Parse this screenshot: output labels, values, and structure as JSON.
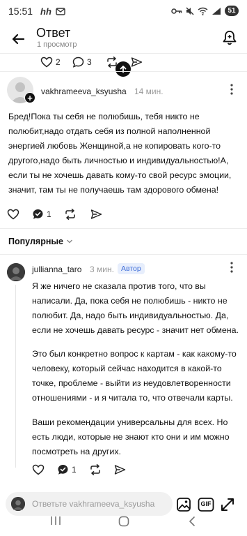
{
  "status_bar": {
    "time": "15:51",
    "battery": "51",
    "icons": [
      "hh-icon",
      "mail-icon",
      "key-icon",
      "mute-icon",
      "wifi-icon",
      "signal-icon",
      "battery-icon"
    ]
  },
  "header": {
    "title": "Ответ",
    "subtitle": "1 просмотр"
  },
  "prev_actions": {
    "likes": "2",
    "comments": "3"
  },
  "comment1": {
    "author": "vakhrameeva_ksyusha",
    "time": "14 мин.",
    "text": "Бред!Пока ты себя не полюбишь, тебя никто не полюбит,надо отдать себя из полной наполненной энергией любовь Женщиной,а не копировать кого-то другого,надо быть личностью и индивидуальностью!А, если ты не хочешь давать кому-то свой ресурс эмоции, значит, там ты не получаешь там здорового обмена!",
    "comments": "1"
  },
  "sort": {
    "label": "Популярные"
  },
  "comment2": {
    "author": "jullianna_taro",
    "time": "3 мин.",
    "badge": "Автор",
    "paragraphs": [
      "Я же ничего не сказала против того, что вы написали. Да, пока себя не полюбишь - никто не полюбит. Да, надо быть индивидуальностью. Да, если не хочешь давать ресурс - значит нет обмена.",
      "Это был конкретно вопрос к картам - как какому-то человеку, который сейчас находится в какой-то точке, проблеме - выйти из неудовлетворенности отношениями - и я читала то, что отвечали карты.",
      "Ваши рекомендации универсальны для всех. Но есть люди, которые не знают кто они и им можно посмотреть на других."
    ],
    "comments": "1"
  },
  "reply": {
    "placeholder": "Ответьте vakhrameeva_ksyusha",
    "gif_label": "GIF"
  },
  "colors": {
    "accent": "#3f6ed8",
    "badge_bg": "#e7eefc",
    "text": "#111111",
    "muted": "#999999"
  }
}
